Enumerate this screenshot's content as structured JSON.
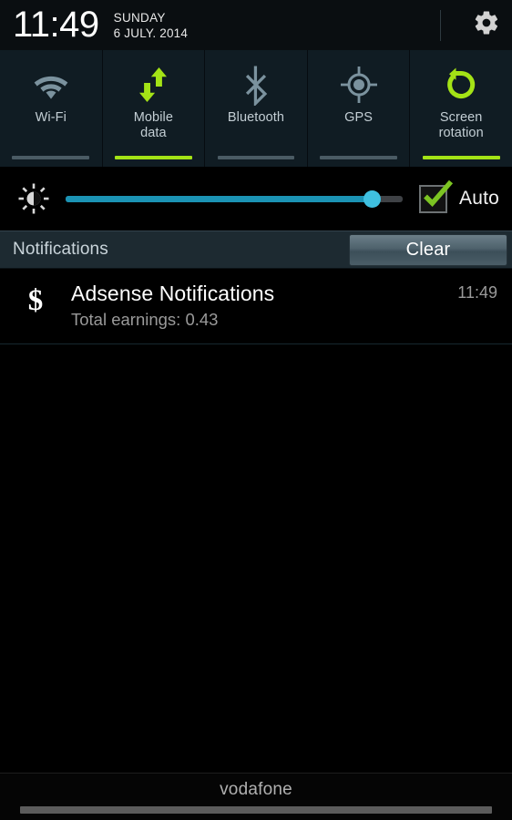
{
  "header": {
    "clock": "11:49",
    "day": "SUNDAY",
    "date": "6 JULY. 2014",
    "settings_icon": "gear-icon"
  },
  "quick_settings": {
    "items": [
      {
        "label": "Wi-Fi",
        "icon": "wifi-icon",
        "active": false
      },
      {
        "label": "Mobile\ndata",
        "icon": "mobile-data-icon",
        "active": true
      },
      {
        "label": "Bluetooth",
        "icon": "bluetooth-icon",
        "active": false
      },
      {
        "label": "GPS",
        "icon": "gps-icon",
        "active": false
      },
      {
        "label": "Screen\nrotation",
        "icon": "screen-rotation-icon",
        "active": true
      }
    ]
  },
  "brightness": {
    "icon": "brightness-sun-icon",
    "value_percent": 91,
    "auto_label": "Auto",
    "auto_checked": true,
    "fill_color": "#1b93b4",
    "thumb_color": "#3fc0e0"
  },
  "notifications_bar": {
    "title": "Notifications",
    "clear_label": "Clear"
  },
  "notifications": [
    {
      "icon": "dollar-sign-icon",
      "title": "Adsense Notifications",
      "subtitle": "Total earnings: 0.43",
      "time": "11:49"
    }
  ],
  "footer": {
    "carrier": "vodafone"
  },
  "colors": {
    "accent_green": "#a4e316",
    "toggle_bg": "#101c23",
    "inactive_icon": "#78909c",
    "notif_bar_bg": "#1d2a31"
  }
}
